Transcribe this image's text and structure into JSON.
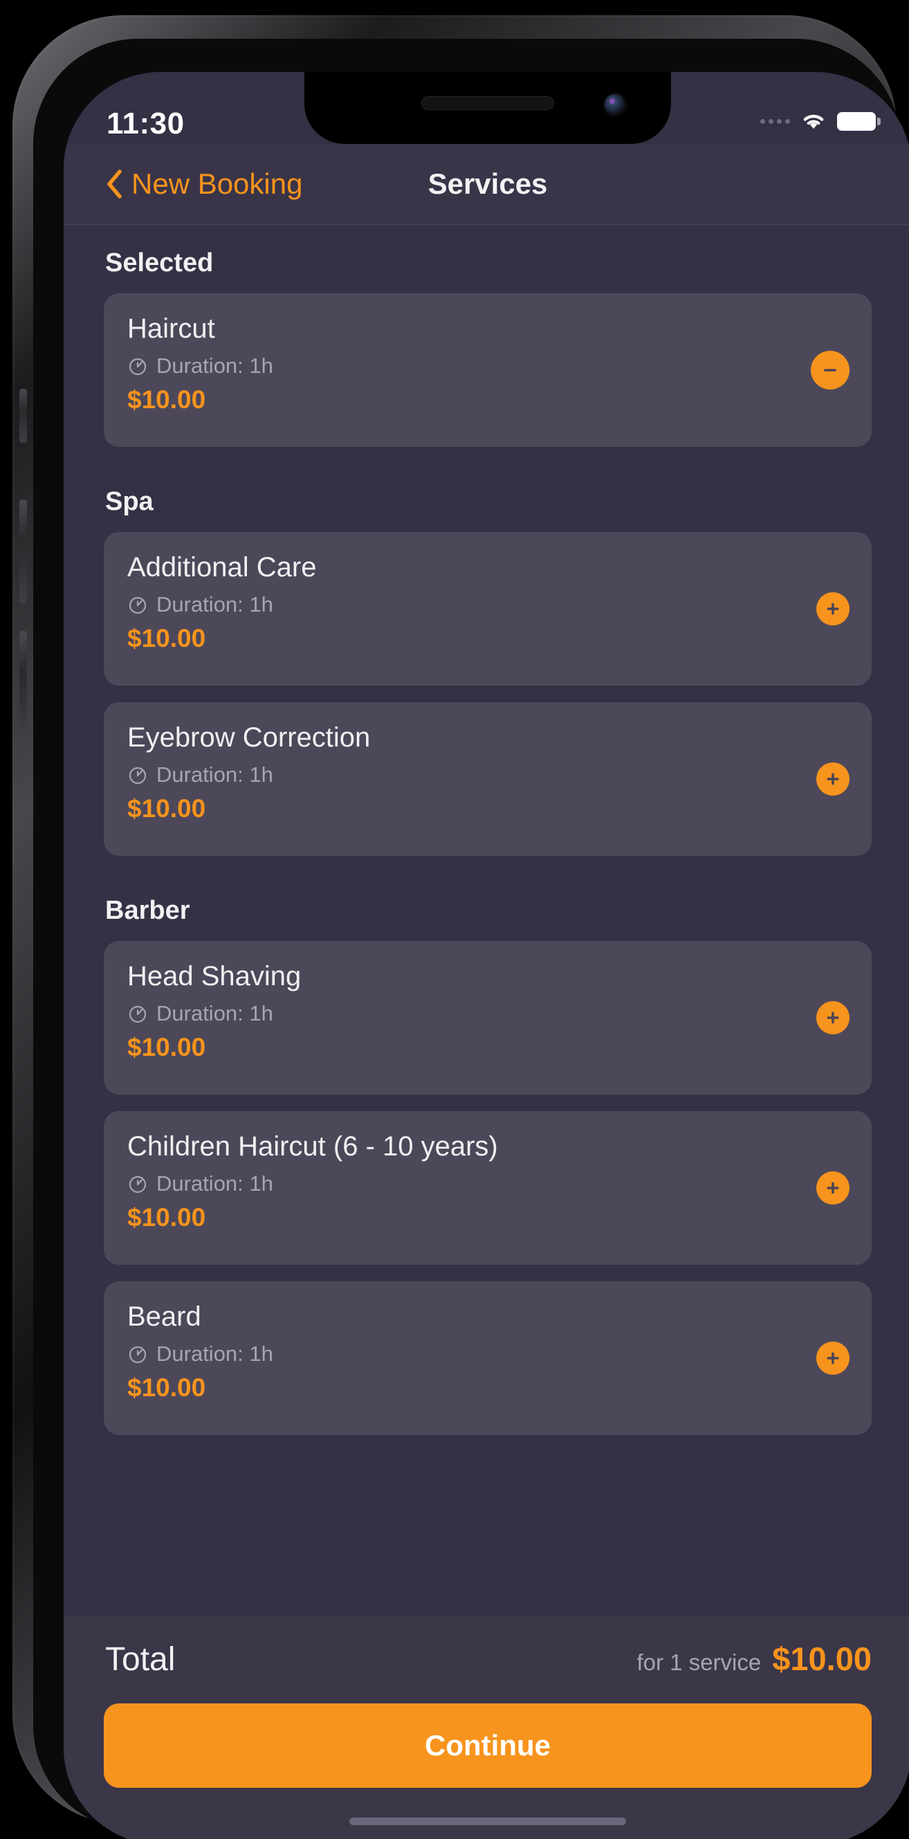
{
  "device": {
    "statusbar": {
      "time": "11:30",
      "cellular_icon": "cellular-dots-icon",
      "wifi_icon": "wifi-icon",
      "battery_icon": "battery-full-icon"
    },
    "home_indicator": "home-indicator"
  },
  "nav": {
    "back_icon": "chevron-left-icon",
    "back_label": "New Booking",
    "title": "Services"
  },
  "colors": {
    "accent": "#F7941D",
    "screen_bg": "#353044",
    "card_bg": "#4D4859",
    "navbar_bg": "#3A3448",
    "bottombar_bg": "#3C3649",
    "primary_text": "#F0F0F2",
    "secondary_text": "#A7A4B5"
  },
  "sections": [
    {
      "title": "Selected",
      "items": [
        {
          "name": "Haircut",
          "duration_icon": "clock-icon",
          "duration": "Duration: 1h",
          "price": "$10.00",
          "action": "remove",
          "action_icon": "minus-circle-icon"
        }
      ]
    },
    {
      "title": "Spa",
      "items": [
        {
          "name": "Additional Care",
          "duration_icon": "clock-icon",
          "duration": "Duration: 1h",
          "price": "$10.00",
          "action": "add",
          "action_icon": "plus-circle-icon"
        },
        {
          "name": "Eyebrow Correction",
          "duration_icon": "clock-icon",
          "duration": "Duration: 1h",
          "price": "$10.00",
          "action": "add",
          "action_icon": "plus-circle-icon"
        }
      ]
    },
    {
      "title": "Barber",
      "items": [
        {
          "name": "Head Shaving",
          "duration_icon": "clock-icon",
          "duration": "Duration: 1h",
          "price": "$10.00",
          "action": "add",
          "action_icon": "plus-circle-icon"
        },
        {
          "name": "Children Haircut (6 - 10 years)",
          "duration_icon": "clock-icon",
          "duration": "Duration: 1h",
          "price": "$10.00",
          "action": "add",
          "action_icon": "plus-circle-icon"
        },
        {
          "name": "Beard",
          "duration_icon": "clock-icon",
          "duration": "Duration: 1h",
          "price": "$10.00",
          "action": "add",
          "action_icon": "plus-circle-icon"
        }
      ]
    }
  ],
  "footer": {
    "total_label": "Total",
    "total_subtext": "for 1 service",
    "total_amount": "$10.00",
    "continue_label": "Continue"
  }
}
